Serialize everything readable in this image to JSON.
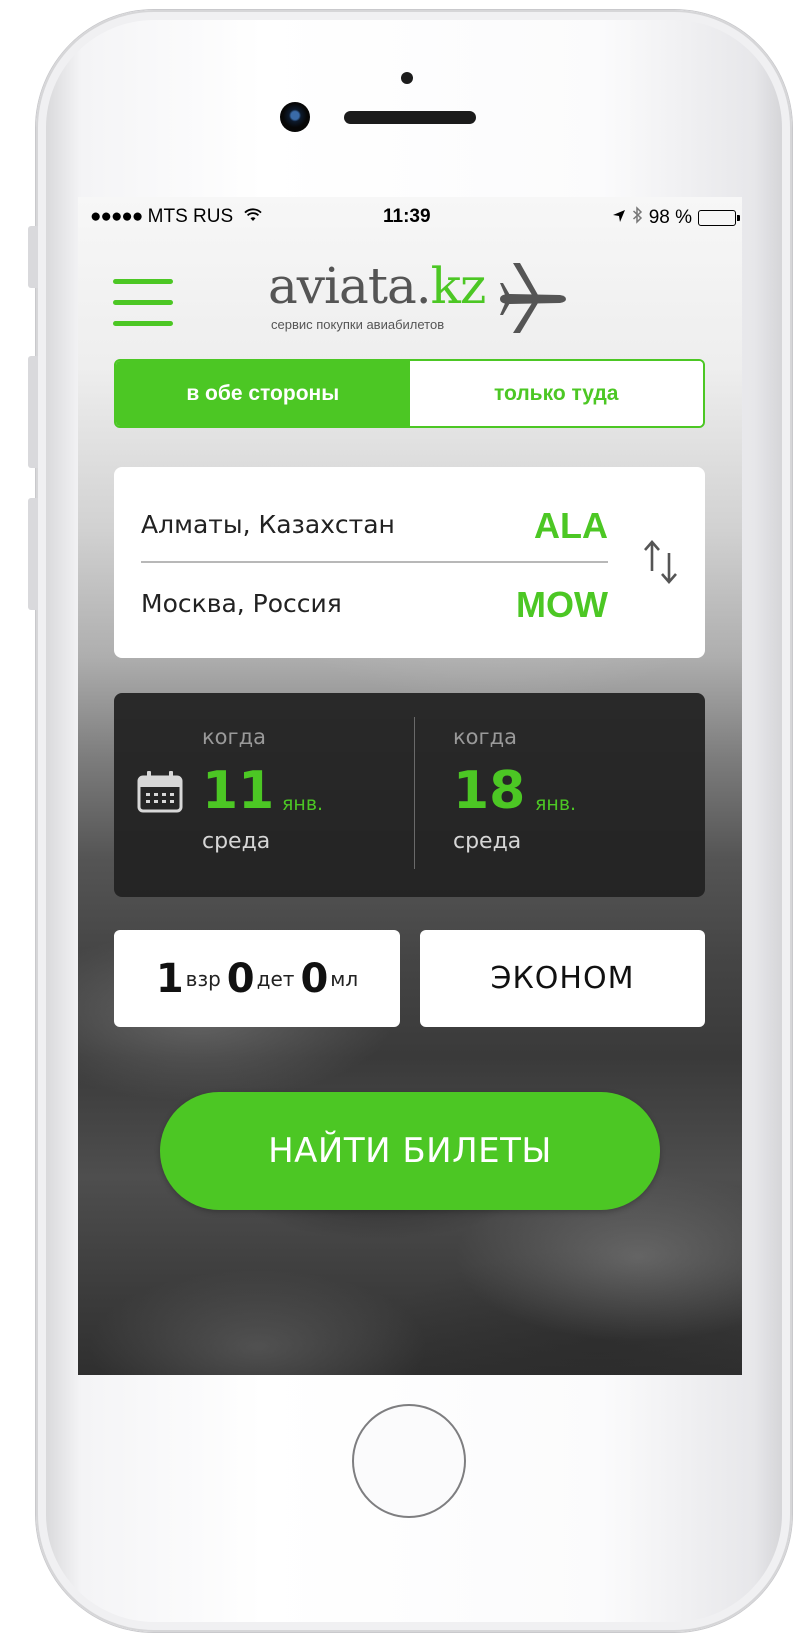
{
  "status_bar": {
    "signal_dots": "●●●●●",
    "carrier": "MTS RUS",
    "wifi_icon": "wifi-icon",
    "time": "11:39",
    "location_icon": "location-arrow-icon",
    "bluetooth_icon": "bluetooth-icon",
    "battery": "98 %"
  },
  "header": {
    "menu_icon": "hamburger-menu-icon",
    "logo_main": "aviata.",
    "logo_accent": "kz",
    "logo_subtitle": "сервис покупки авиабилетов",
    "logo_icon": "airplane-icon"
  },
  "trip_type": {
    "round_trip": "в обе стороны",
    "one_way": "только туда",
    "selected": "round_trip"
  },
  "route": {
    "from_city": "Алматы, Казахстан",
    "from_code": "ALA",
    "to_city": "Москва, Россия",
    "to_code": "MOW",
    "swap_icon": "swap-arrows-icon"
  },
  "dates": {
    "calendar_icon": "calendar-icon",
    "departure": {
      "label": "когда",
      "day": "11",
      "month": "янв.",
      "weekday": "среда"
    },
    "return": {
      "label": "когда",
      "day": "18",
      "month": "янв.",
      "weekday": "среда"
    }
  },
  "passengers": {
    "adults": "1",
    "adults_label": "взр",
    "children": "0",
    "children_label": "дет",
    "infants": "0",
    "infants_label": "мл"
  },
  "cabin_class": "ЭКОНОМ",
  "search_button": "НАЙТИ БИЛЕТЫ",
  "colors": {
    "accent": "#4cc724",
    "dates_card": "#222222",
    "card": "#ffffff"
  }
}
